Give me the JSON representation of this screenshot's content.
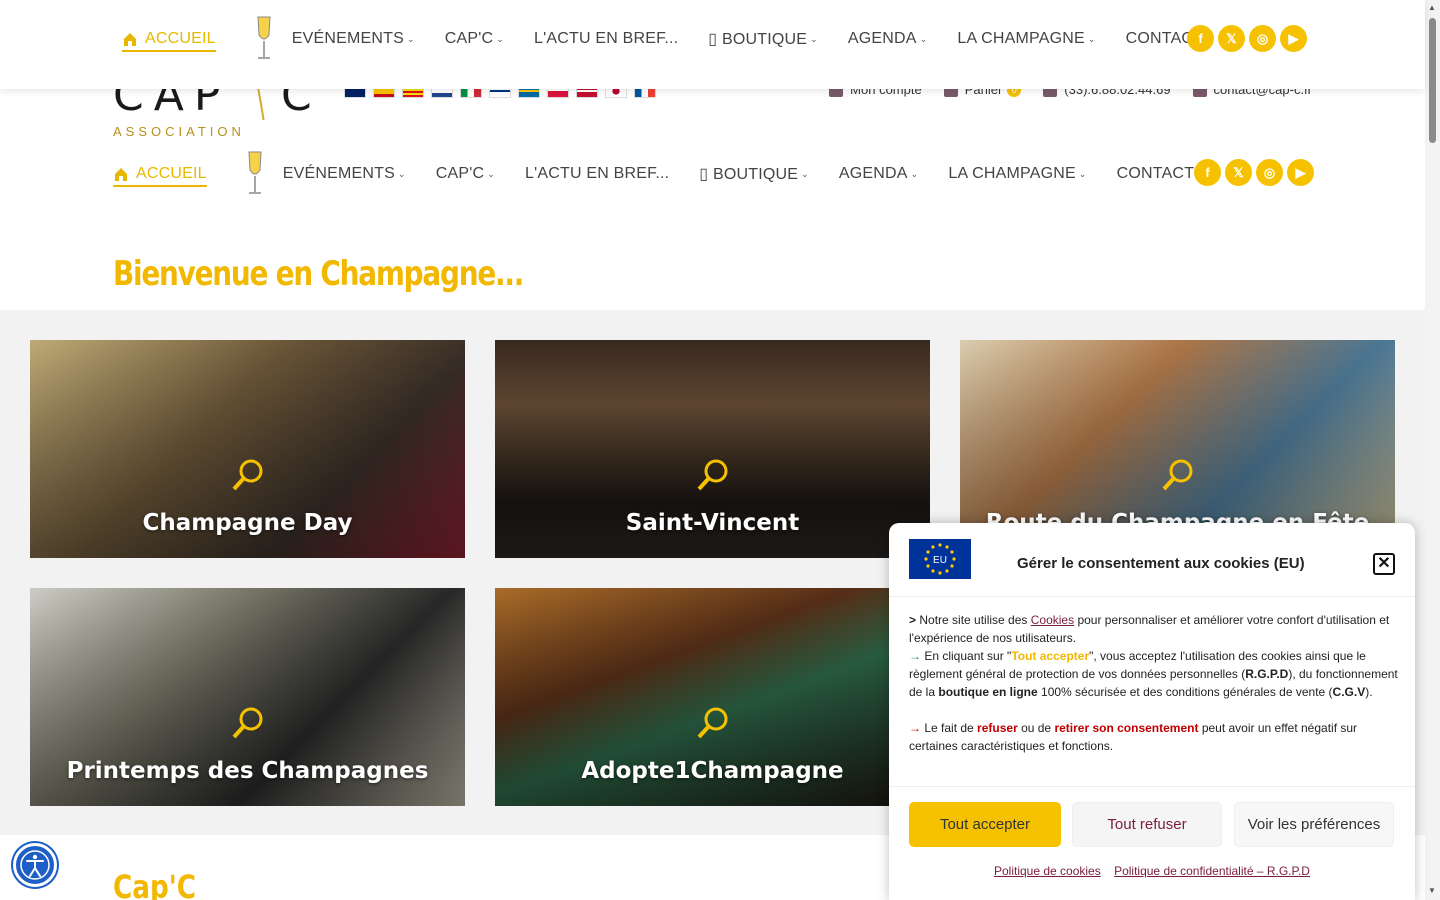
{
  "nav": {
    "home": "ACCUEIL",
    "items": [
      {
        "label": "EVÉNEMENTS",
        "has_chevron": true
      },
      {
        "label": "CAP'C",
        "has_chevron": true
      },
      {
        "label": "L'ACTU EN BREF...",
        "has_chevron": false
      },
      {
        "label": "▯ BOUTIQUE",
        "has_chevron": true
      },
      {
        "label": "AGENDA",
        "has_chevron": true
      },
      {
        "label": "LA CHAMPAGNE",
        "has_chevron": true
      },
      {
        "label": "CONTACT",
        "has_chevron": false
      }
    ],
    "socials": [
      "facebook-icon",
      "x-icon",
      "instagram-icon",
      "youtube-icon"
    ]
  },
  "logo": {
    "sub": "ASSOCIATION"
  },
  "toplinks": {
    "account": "Mon compte",
    "cart": "Panier",
    "cart_count": "0",
    "phone": "(33).6.88.02.44.69",
    "email": "contact@cap-c.fr"
  },
  "flags": [
    "uk-flag",
    "spain-flag",
    "catalonia-flag",
    "netherlands-flag",
    "italy-flag",
    "finland-flag",
    "sweden-flag",
    "poland-flag",
    "denmark-flag",
    "japan-flag",
    "france-flag"
  ],
  "welcome": "Bienvenue en Champagne...",
  "cards": [
    {
      "title": "Champagne Day"
    },
    {
      "title": "Saint-Vincent"
    },
    {
      "title": "Route du Champagne en Fête"
    },
    {
      "title": "Printemps des Champagnes"
    },
    {
      "title": "Adopte1Champagne"
    }
  ],
  "section_title": "Cap'C",
  "cookie": {
    "eu_label": "EU",
    "title": "Gérer le consentement aux cookies (EU)",
    "p1_a": "Notre site utilise des ",
    "p1_link": "Cookies",
    "p1_b": " pour personnaliser et améliorer votre confort d'utilisation et l'expérience de nos utilisateurs.",
    "p2_a": " En cliquant sur \"",
    "p2_accept": "Tout accepter",
    "p2_b": "\", vous acceptez l'utilisation des cookies ainsi que le règlement général de protection de vos données personnelles (",
    "p2_rgpd": "R.G.P.D",
    "p2_c": "), du fonctionnement de la ",
    "p2_shop": "boutique en ligne",
    "p2_d": " 100% sécurisée et des conditions générales de vente (",
    "p2_cgv": "C.G.V",
    "p2_e": ").",
    "p3_a": " Le fait de ",
    "p3_refuse": "refuser",
    "p3_b": " ou de ",
    "p3_withdraw": "retirer son consentement",
    "p3_c": " peut avoir un effet négatif sur certaines caractéristiques et fonctions.",
    "btn_accept": "Tout accepter",
    "btn_refuse": "Tout refuser",
    "btn_prefs": "Voir les préférences",
    "policy_cookies": "Politique de cookies",
    "policy_privacy": "Politique de confidentialité – R.G.P.D"
  },
  "colors": {
    "gold": "#f6c200",
    "burgundy": "#7a1e3a",
    "accessibility": "#1e5fc7"
  }
}
